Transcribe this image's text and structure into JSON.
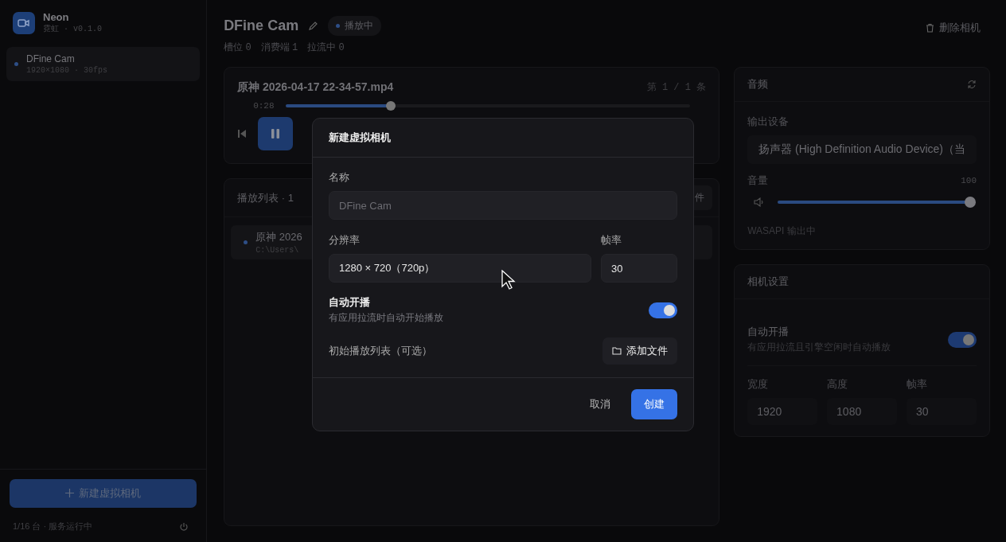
{
  "app": {
    "name": "Neon",
    "subtitle": "霓虹 · v0.1.0"
  },
  "cameras": [
    {
      "name": "DFine Cam",
      "info": "1920×1080 · 30fps",
      "selected": true
    }
  ],
  "new_camera_button": "新建虚拟相机",
  "status": "1/16 台 · 服务运行中",
  "header": {
    "title": "DFine Cam",
    "status_badge": "播放中",
    "delete_button": "删除相机",
    "stats": [
      {
        "label": "槽位",
        "value": "0"
      },
      {
        "label": "消费端",
        "value": "1"
      },
      {
        "label": "拉流中",
        "value": "0"
      }
    ]
  },
  "player": {
    "file": "原神 2026-04-17 22-34-57.mp4",
    "position": "第 1 / 1 条",
    "elapsed": "0:28",
    "level": 0.26,
    "playing": true
  },
  "playlist": {
    "title": "播放列表 · 1",
    "add_button": "件",
    "items": [
      {
        "name": "原神 2026",
        "path": "C:\\Users\\",
        "selected": true
      }
    ]
  },
  "audio": {
    "title": "音频",
    "output_label": "输出设备",
    "device": "扬声器 (High Definition Audio Device)（当",
    "volume_label": "音量",
    "volume_value": "100",
    "level": 1.0,
    "status": "WASAPI 输出中"
  },
  "camera_settings": {
    "title": "相机设置",
    "autoplay": {
      "label": "自动开播",
      "hint": "有应用拉流且引擎空闲时自动播放",
      "on": true
    },
    "fields": [
      {
        "label": "宽度",
        "value": "1920"
      },
      {
        "label": "高度",
        "value": "1080"
      },
      {
        "label": "帧率",
        "value": "30"
      }
    ]
  },
  "dialog": {
    "title": "新建虚拟相机",
    "name_label": "名称",
    "name_placeholder": "DFine Cam",
    "resolution_label": "分辨率",
    "resolution": "1280 × 720（720p）",
    "fps_label": "帧率",
    "fps": "30",
    "autoplay": {
      "label": "自动开播",
      "hint": "有应用拉流时自动开始播放",
      "on": true
    },
    "playlist_label": "初始播放列表（可选）",
    "add_file_button": "添加文件",
    "cancel_button": "取消",
    "create_button": "创建"
  }
}
